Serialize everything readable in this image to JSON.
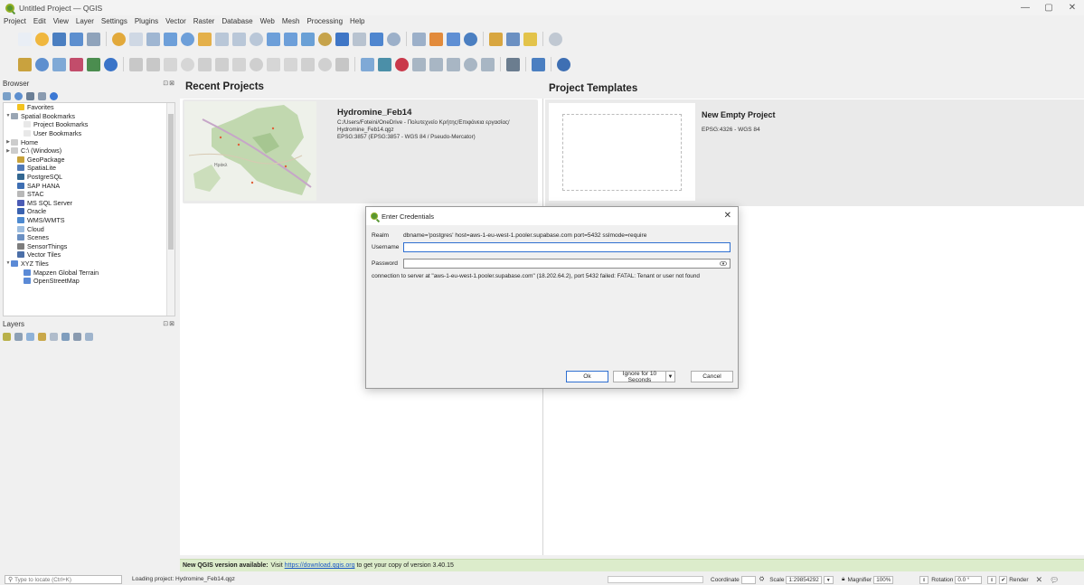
{
  "window": {
    "title": "Untitled Project — QGIS",
    "minimize": "—",
    "maximize": "▢",
    "close": "✕"
  },
  "menu": [
    "Project",
    "Edit",
    "View",
    "Layer",
    "Settings",
    "Plugins",
    "Vector",
    "Raster",
    "Database",
    "Web",
    "Mesh",
    "Processing",
    "Help"
  ],
  "browser": {
    "title": "Browser",
    "items": [
      {
        "label": "Favorites",
        "indent": 1,
        "arrow": "",
        "icon": "#f3c21e"
      },
      {
        "label": "Spatial Bookmarks",
        "indent": 0,
        "arrow": "▼",
        "icon": "#9aa6b4"
      },
      {
        "label": "Project Bookmarks",
        "indent": 2,
        "arrow": "",
        "icon": "#e8e8e8"
      },
      {
        "label": "User Bookmarks",
        "indent": 2,
        "arrow": "",
        "icon": "#e8e8e8"
      },
      {
        "label": "Home",
        "indent": 0,
        "arrow": "▶",
        "icon": "#cccccc"
      },
      {
        "label": "C:\\ (Windows)",
        "indent": 0,
        "arrow": "▶",
        "icon": "#cccccc"
      },
      {
        "label": "GeoPackage",
        "indent": 1,
        "arrow": "",
        "icon": "#c8a23a"
      },
      {
        "label": "SpatiaLite",
        "indent": 1,
        "arrow": "",
        "icon": "#4f79b8"
      },
      {
        "label": "PostgreSQL",
        "indent": 1,
        "arrow": "",
        "icon": "#336791"
      },
      {
        "label": "SAP HANA",
        "indent": 1,
        "arrow": "",
        "icon": "#3e6fb3"
      },
      {
        "label": "STAC",
        "indent": 1,
        "arrow": "",
        "icon": "#b8b8b8"
      },
      {
        "label": "MS SQL Server",
        "indent": 1,
        "arrow": "",
        "icon": "#4b5bb5"
      },
      {
        "label": "Oracle",
        "indent": 1,
        "arrow": "",
        "icon": "#3a62b0"
      },
      {
        "label": "WMS/WMTS",
        "indent": 1,
        "arrow": "",
        "icon": "#4e8ad0"
      },
      {
        "label": "Cloud",
        "indent": 1,
        "arrow": "",
        "icon": "#9dbde0"
      },
      {
        "label": "Scenes",
        "indent": 1,
        "arrow": "",
        "icon": "#6a8fc2"
      },
      {
        "label": "SensorThings",
        "indent": 1,
        "arrow": "",
        "icon": "#7d7d7d"
      },
      {
        "label": "Vector Tiles",
        "indent": 1,
        "arrow": "",
        "icon": "#4b6fa8"
      },
      {
        "label": "XYZ Tiles",
        "indent": 0,
        "arrow": "▼",
        "icon": "#5b8ad6"
      },
      {
        "label": "Mapzen Global Terrain",
        "indent": 2,
        "arrow": "",
        "icon": "#5b8ad6"
      },
      {
        "label": "OpenStreetMap",
        "indent": 2,
        "arrow": "",
        "icon": "#5b8ad6"
      }
    ]
  },
  "layers": {
    "title": "Layers"
  },
  "panel_controls": "⊡⊠",
  "recent": {
    "title": "Recent Projects",
    "project": {
      "name": "Hydromine_Feb14",
      "path1": "C:/Users/Foteini/OneDrive - Πολυτεχνείο Κρήτης/Επιφάνεια εργασίας/",
      "path2": "Hydromine_Feb14.qgz",
      "crs": "EPSG:3857 (EPSG:3857 - WGS 84 / Pseudo-Mercator)",
      "map_label": "Ηράκλ"
    }
  },
  "templates": {
    "title": "Project Templates",
    "name": "New Empty Project",
    "crs": "EPSG:4326 - WGS 84"
  },
  "message_bar": {
    "bold": "New QGIS version available:",
    "pre": "Visit",
    "link": "https://download.qgis.org",
    "post": "to get your copy of version 3.40.15"
  },
  "status": {
    "locator_placeholder": "Type to locate (Ctrl+K)",
    "message": "Loading project: Hydromine_Feb14.qgz",
    "coordinate_label": "Coordinate",
    "scale_label": "Scale",
    "scale_value": "1:29854292",
    "magnifier_label": "Magnifier",
    "magnifier_value": "100%",
    "rotation_label": "Rotation",
    "rotation_value": "0.0 °",
    "render_label": "Render"
  },
  "dialog": {
    "title": "Enter Credentials",
    "realm_label": "Realm",
    "realm_value": "dbname='postgres' host=aws-1-eu-west-1.pooler.supabase.com port=5432 sslmode=require",
    "username_label": "Username",
    "username_value": "",
    "password_label": "Password",
    "password_value": "",
    "error": "connection to server at \"aws-1-eu-west-1.pooler.supabase.com\" (18.202.64.2), port 5432 failed: FATAL:  Tenant or user not found",
    "ok": "Ok",
    "ignore": "Ignore for 10 Seconds",
    "cancel": "Cancel"
  },
  "colors": {
    "accent": "#2f6fd1",
    "message_bar": "#dceccb",
    "qgis_green": "#589632"
  }
}
